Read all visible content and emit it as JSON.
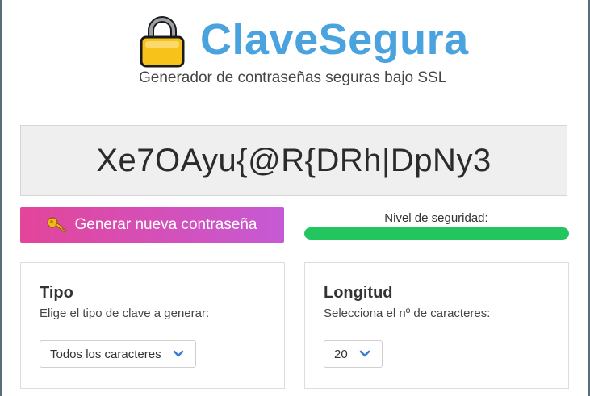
{
  "header": {
    "brand": "ClaveSegura",
    "subtitle": "Generador de contraseñas seguras bajo SSL",
    "lock_icon": "lock-icon"
  },
  "password": {
    "value": "Xe7OAyu{@R{DRh|DpNy3"
  },
  "generate_button": {
    "label": "Generar nueva contraseña",
    "icon": "key-icon"
  },
  "security": {
    "label": "Nivel de seguridad:",
    "level": 1.0,
    "color": "#22c55e"
  },
  "type_card": {
    "title": "Tipo",
    "description": "Elige el tipo de clave a generar:",
    "selected": "Todos los caracteres"
  },
  "length_card": {
    "title": "Longitud",
    "description": "Selecciona el nº de caracteres:",
    "selected": "20"
  },
  "colors": {
    "brand": "#4aa3df",
    "button_gradient_start": "#e3459a",
    "button_gradient_end": "#c65ad4",
    "chevron": "#3a7bd5"
  }
}
